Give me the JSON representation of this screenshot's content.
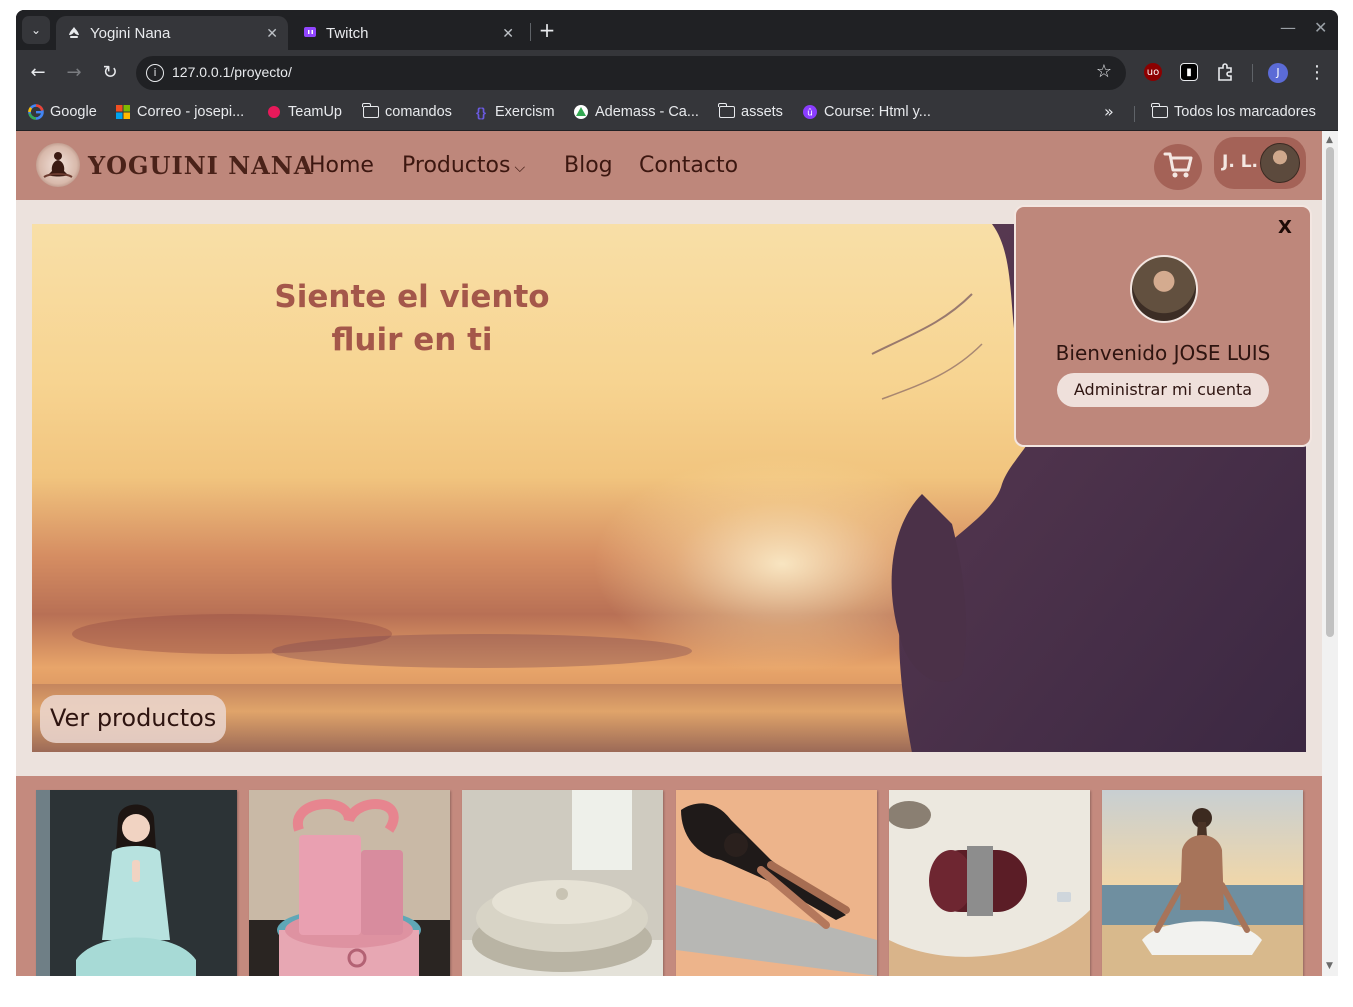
{
  "browser": {
    "tabs": [
      {
        "title": "Yogini Nana",
        "active": true,
        "favicon": "lotus-icon"
      },
      {
        "title": "Twitch",
        "active": false,
        "favicon": "twitch-icon"
      }
    ],
    "url": "127.0.0.1/proyecto/",
    "profile_initial": "J",
    "bookmarks": [
      {
        "label": "Google",
        "icon": "google-icon"
      },
      {
        "label": "Correo - josepi...",
        "icon": "microsoft-icon"
      },
      {
        "label": "TeamUp",
        "icon": "teamup-icon"
      },
      {
        "label": "comandos",
        "icon": "folder-icon"
      },
      {
        "label": "Exercism",
        "icon": "exercism-icon"
      },
      {
        "label": "Ademass - Ca...",
        "icon": "ademass-icon"
      },
      {
        "label": "assets",
        "icon": "folder-icon"
      },
      {
        "label": "Course: Html y...",
        "icon": "course-icon"
      }
    ],
    "all_bookmarks_label": "Todos los marcadores"
  },
  "site": {
    "brand": "YOGUINI NANA",
    "nav": {
      "home": "Home",
      "productos": "Productos",
      "blog": "Blog",
      "contacto": "Contacto"
    },
    "user_initials": "J. L.",
    "hero": {
      "title_line1": "Siente el viento",
      "title_line2": "fluir en ti",
      "cta": "Ver productos"
    },
    "popover": {
      "close": "X",
      "welcome": "Bienvenido JOSE LUIS",
      "manage": "Administrar mi cuenta"
    },
    "products": [
      {
        "name": "meditation-woman-image"
      },
      {
        "name": "yoga-blocks-image"
      },
      {
        "name": "meditation-cushion-image"
      },
      {
        "name": "yoga-mat-pose-image"
      },
      {
        "name": "rolled-mat-image"
      },
      {
        "name": "beach-meditation-image"
      }
    ]
  },
  "colors": {
    "header": "#be877b",
    "page_bg": "#ece2dd",
    "accent_dark": "#a46257",
    "hero_title": "#a4574a"
  }
}
